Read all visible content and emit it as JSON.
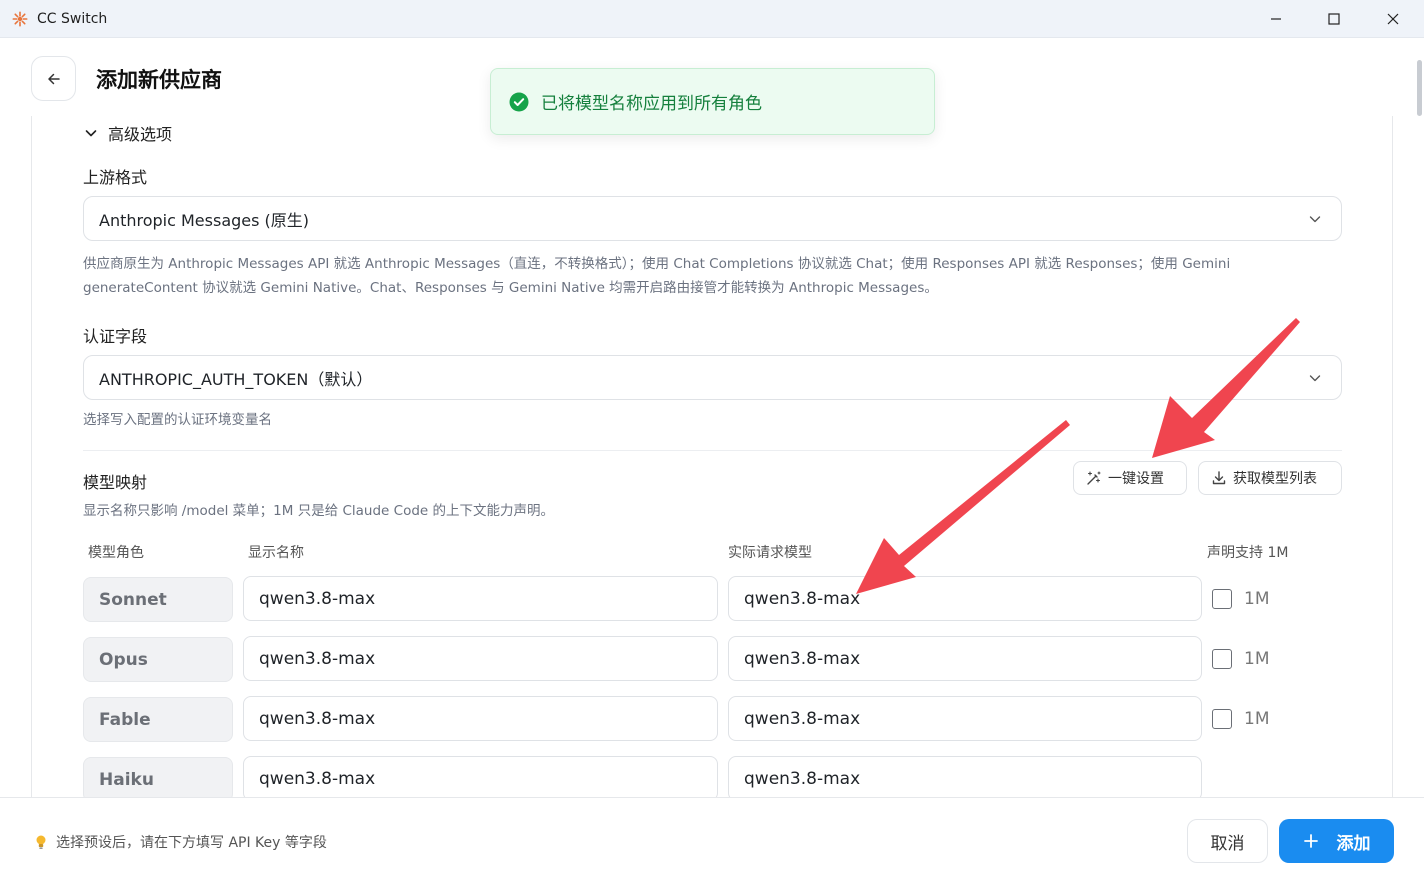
{
  "window": {
    "title": "CC Switch"
  },
  "header": {
    "title": "添加新供应商"
  },
  "toast": {
    "message": "已将模型名称应用到所有角色"
  },
  "advanced": {
    "toggle_label": "高级选项",
    "upstream_format": {
      "label": "上游格式",
      "value": "Anthropic Messages (原生)",
      "hint_line1": "供应商原生为 Anthropic Messages API 就选 Anthropic Messages（直连，不转换格式）；使用 Chat Completions 协议就选 Chat；使用 Responses API 就选 Responses；使用 Gemini",
      "hint_line2": "generateContent 协议就选 Gemini Native。Chat、Responses 与 Gemini Native 均需开启路由接管才能转换为 Anthropic Messages。"
    },
    "auth_field": {
      "label": "认证字段",
      "value": "ANTHROPIC_AUTH_TOKEN（默认）",
      "hint": "选择写入配置的认证环境变量名"
    }
  },
  "model_mapping": {
    "title": "模型映射",
    "hint": "显示名称只影响 /model 菜单；1M 只是给 Claude Code 的上下文能力声明。",
    "quick_setup_label": "一键设置",
    "fetch_models_label": "获取模型列表",
    "columns": {
      "role": "模型角色",
      "display": "显示名称",
      "actual": "实际请求模型",
      "support_1m": "声明支持 1M"
    },
    "rows": [
      {
        "role": "Sonnet",
        "display": "qwen3.8-max",
        "actual": "qwen3.8-max",
        "checkbox_label": "1M",
        "has_checkbox": true
      },
      {
        "role": "Opus",
        "display": "qwen3.8-max",
        "actual": "qwen3.8-max",
        "checkbox_label": "1M",
        "has_checkbox": true
      },
      {
        "role": "Fable",
        "display": "qwen3.8-max",
        "actual": "qwen3.8-max",
        "checkbox_label": "1M",
        "has_checkbox": true
      },
      {
        "role": "Haiku",
        "display": "qwen3.8-max",
        "actual": "qwen3.8-max",
        "checkbox_label": "",
        "has_checkbox": false
      }
    ]
  },
  "footer": {
    "hint": "选择预设后，请在下方填写 API Key 等字段",
    "cancel_label": "取消",
    "add_label": "添加"
  },
  "colors": {
    "accent": "#1a8cf0",
    "toast_bg": "#ecfbf1",
    "toast_text": "#15803d",
    "annotation_arrow": "#f0454f"
  }
}
